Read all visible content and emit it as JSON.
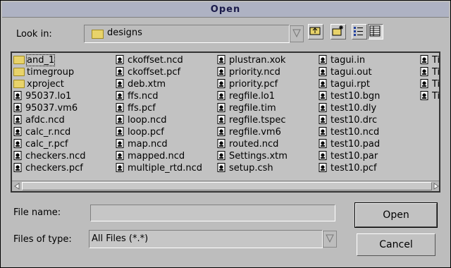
{
  "dialog": {
    "title": "Open"
  },
  "look_in": {
    "label": "Look in:",
    "value": "designs"
  },
  "files": {
    "columns": [
      [
        {
          "name": "and_1",
          "type": "folder"
        },
        {
          "name": "timegroup",
          "type": "folder"
        },
        {
          "name": "xproject",
          "type": "folder"
        },
        {
          "name": "95037.lo1",
          "type": "file"
        },
        {
          "name": "95037.vm6",
          "type": "file"
        },
        {
          "name": "afdc.ncd",
          "type": "file"
        },
        {
          "name": "calc_r.ncd",
          "type": "file"
        },
        {
          "name": "calc_r.pcf",
          "type": "file"
        },
        {
          "name": "checkers.ncd",
          "type": "file"
        },
        {
          "name": "checkers.pcf",
          "type": "file"
        }
      ],
      [
        {
          "name": "ckoffset.ncd",
          "type": "file"
        },
        {
          "name": "ckoffset.pcf",
          "type": "file"
        },
        {
          "name": "deb.xtm",
          "type": "file"
        },
        {
          "name": "ffs.ncd",
          "type": "file"
        },
        {
          "name": "ffs.pcf",
          "type": "file"
        },
        {
          "name": "loop.ncd",
          "type": "file"
        },
        {
          "name": "loop.pcf",
          "type": "file"
        },
        {
          "name": "map.ncd",
          "type": "file"
        },
        {
          "name": "mapped.ncd",
          "type": "file"
        },
        {
          "name": "multiple_rtd.ncd",
          "type": "file"
        }
      ],
      [
        {
          "name": "plustran.xok",
          "type": "file"
        },
        {
          "name": "priority.ncd",
          "type": "file"
        },
        {
          "name": "priority.pcf",
          "type": "file"
        },
        {
          "name": "regfile.lo1",
          "type": "file"
        },
        {
          "name": "regfile.tim",
          "type": "file"
        },
        {
          "name": "regfile.tspec",
          "type": "file"
        },
        {
          "name": "regfile.vm6",
          "type": "file"
        },
        {
          "name": "routed.ncd",
          "type": "file"
        },
        {
          "name": "Settings.xtm",
          "type": "file"
        },
        {
          "name": "setup.csh",
          "type": "file"
        }
      ],
      [
        {
          "name": "tagui.in",
          "type": "file"
        },
        {
          "name": "tagui.out",
          "type": "file"
        },
        {
          "name": "tagui.rpt",
          "type": "file"
        },
        {
          "name": "test10.bgn",
          "type": "file"
        },
        {
          "name": "test10.dly",
          "type": "file"
        },
        {
          "name": "test10.drc",
          "type": "file"
        },
        {
          "name": "test10.ncd",
          "type": "file"
        },
        {
          "name": "test10.pad",
          "type": "file"
        },
        {
          "name": "test10.par",
          "type": "file"
        },
        {
          "name": "test10.pcf",
          "type": "file"
        }
      ],
      [
        {
          "name": "Tir",
          "type": "file"
        },
        {
          "name": "Tir",
          "type": "file"
        },
        {
          "name": "Tir",
          "type": "file"
        },
        {
          "name": "Tir",
          "type": "file"
        }
      ]
    ]
  },
  "file_name": {
    "label": "File name:",
    "value": ""
  },
  "files_of_type": {
    "label": "Files of type:",
    "value": "All Files (*.*)"
  },
  "buttons": {
    "open": "Open",
    "cancel": "Cancel"
  }
}
